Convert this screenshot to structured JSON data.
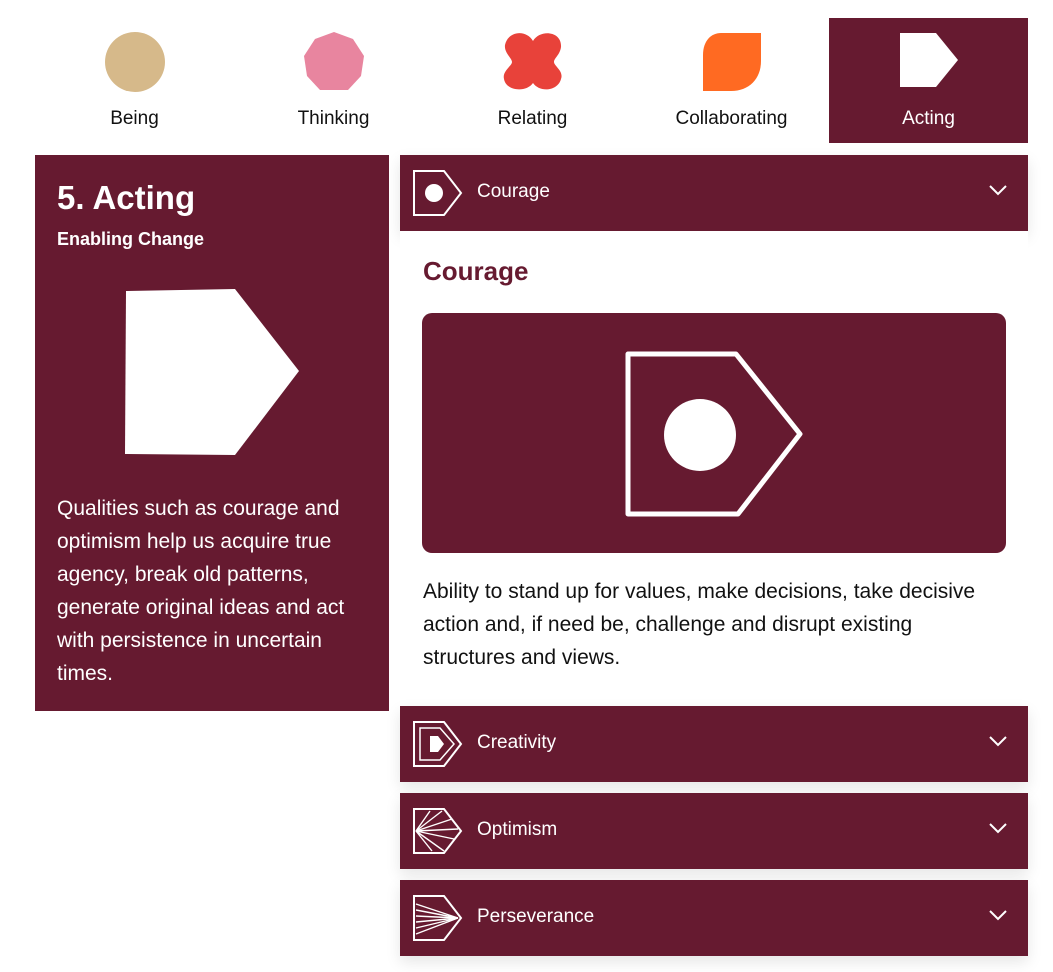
{
  "tabs": [
    {
      "label": "Being",
      "color": "#d6b98a",
      "icon": "circle-shape-icon",
      "active": false
    },
    {
      "label": "Thinking",
      "color": "#e8859f",
      "icon": "nonagon-shape-icon",
      "active": false
    },
    {
      "label": "Relating",
      "color": "#e8423a",
      "icon": "quatrefoil-shape-icon",
      "active": false
    },
    {
      "label": "Collaborating",
      "color": "#ff6a22",
      "icon": "leaf-shape-icon",
      "active": false
    },
    {
      "label": "Acting",
      "color": "#ffffff",
      "icon": "pentagon-arrow-shape-icon",
      "active": true
    }
  ],
  "info": {
    "title": "5. Acting",
    "subtitle": "Enabling Change",
    "description": "Qualities such as courage and optimism help us acquire true agency, break old patterns, generate original ideas and act with persistence in uncertain times."
  },
  "accordion": {
    "items": [
      {
        "label": "Courage",
        "icon": "courage-icon",
        "expanded": true
      },
      {
        "label": "Creativity",
        "icon": "creativity-icon",
        "expanded": false
      },
      {
        "label": "Optimism",
        "icon": "optimism-icon",
        "expanded": false
      },
      {
        "label": "Perseverance",
        "icon": "perseverance-icon",
        "expanded": false
      }
    ],
    "open_panel": {
      "heading": "Courage",
      "text": "Ability to stand up for values, make decisions, take decisive action and, if need be, challenge and disrupt existing structures and views."
    }
  },
  "colors": {
    "brand": "#661a30",
    "background": "#ffffff"
  }
}
